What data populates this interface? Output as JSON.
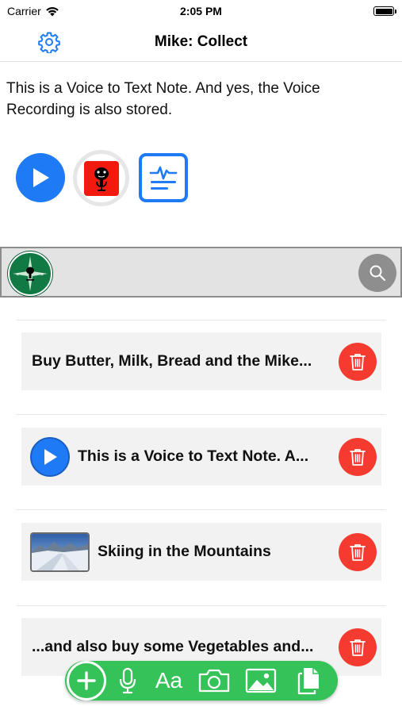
{
  "status_bar": {
    "carrier": "Carrier",
    "time": "2:05 PM"
  },
  "nav": {
    "title": "Mike: Collect",
    "settings_icon": "gear-icon"
  },
  "note": {
    "text": "This is a Voice to Text Note. And yes, the Voice Recording is also stored."
  },
  "controls": {
    "play_icon": "play-icon",
    "record_icon": "microphone-icon",
    "transcript_icon": "transcript-icon"
  },
  "search": {
    "logo_icon": "compass-logo-icon",
    "search_icon": "search-icon"
  },
  "items": [
    {
      "title": "Buy Butter, Milk, Bread and the Mike...",
      "kind": "text"
    },
    {
      "title": "This is a Voice to Text Note. A...",
      "kind": "audio"
    },
    {
      "title": "Skiing in the Mountains",
      "kind": "image"
    },
    {
      "title": "...and also buy some Vegetables and...",
      "kind": "text"
    }
  ],
  "toolbar": {
    "add_icon": "plus-icon",
    "mic_icon": "microphone-icon",
    "text_label": "Aa",
    "camera_icon": "camera-icon",
    "photo_icon": "photo-icon",
    "docs_icon": "documents-icon"
  },
  "colors": {
    "accent": "#1e7af5",
    "record": "#f21a0e",
    "delete": "#f53b30",
    "toolbar": "#35c259"
  }
}
